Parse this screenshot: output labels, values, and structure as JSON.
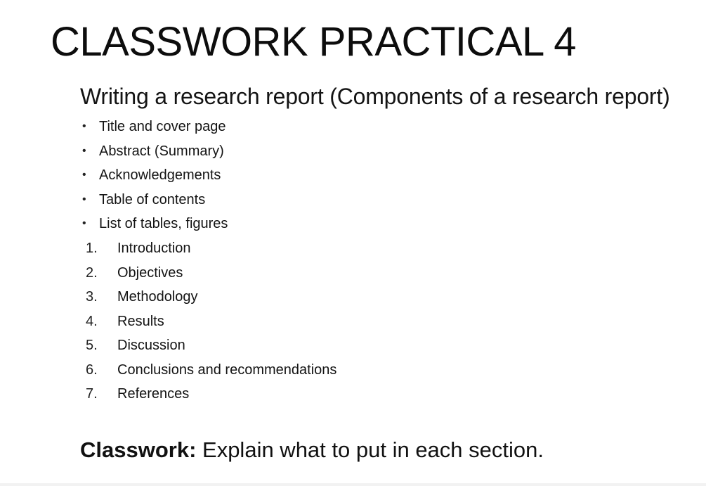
{
  "slide": {
    "title": "CLASSWORK PRACTICAL 4",
    "subtitle": "Writing a research report (Components of a research report)",
    "bullet_symbol": "•",
    "bullets": [
      {
        "label": "Title and cover page"
      },
      {
        "label": "Abstract (Summary)"
      },
      {
        "label": "Acknowledgements"
      },
      {
        "label": "Table of contents"
      },
      {
        "label": "List of tables, figures"
      }
    ],
    "numbered": [
      {
        "number": "1.",
        "label": "Introduction"
      },
      {
        "number": "2.",
        "label": "Objectives"
      },
      {
        "number": "3.",
        "label": "Methodology"
      },
      {
        "number": "4.",
        "label": "Results"
      },
      {
        "number": "5.",
        "label": "Discussion"
      },
      {
        "number": "6.",
        "label": "Conclusions and recommendations"
      },
      {
        "number": "7.",
        "label": "References"
      }
    ],
    "classwork": {
      "label": "Classwork:",
      "text": " Explain what to put in each section."
    }
  }
}
